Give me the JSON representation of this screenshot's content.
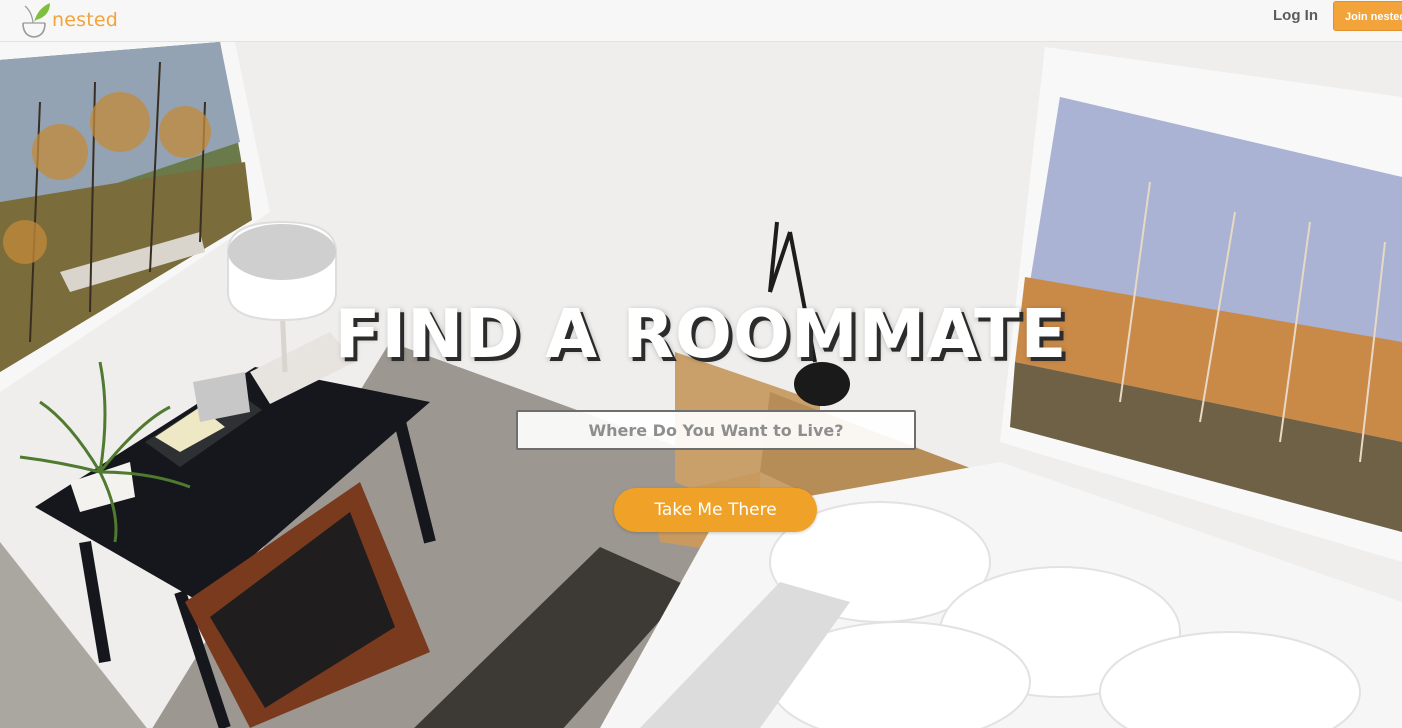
{
  "brand": {
    "name": "nested",
    "accent_color": "#f2a33a",
    "icon": "plant-pot-icon"
  },
  "nav": {
    "login_label": "Log In",
    "join_label": "Join nested"
  },
  "hero": {
    "headline": "FIND A ROOMMATE",
    "search": {
      "placeholder": "Where Do You Want to Live?",
      "value": ""
    },
    "cta_label": "Take Me There",
    "cta_color": "#f0a127",
    "background_image": "bedroom-photo"
  }
}
